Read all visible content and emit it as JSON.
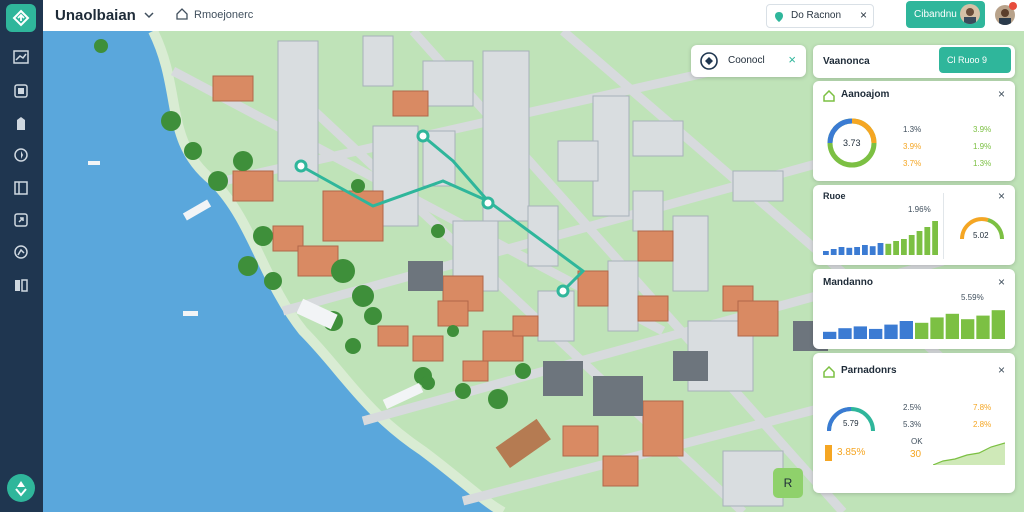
{
  "app": {
    "title": "Unaolbaian",
    "document_title": "Rmoejonerc",
    "search_chip": "Do Racnon",
    "user_button": "Cibandnu"
  },
  "sidebar": {
    "icons": [
      "layers-icon",
      "grid-icon",
      "building-icon",
      "compass-icon",
      "book-icon",
      "share-icon",
      "analytics-icon",
      "stack-icon"
    ],
    "fab_icon": "recycle-icon"
  },
  "map": {
    "popup_label": "Coonocl",
    "map_button_label": "R"
  },
  "panel": {
    "header": {
      "title": "Vaanonca",
      "action_label": "Cl Ruoo 9"
    },
    "card1": {
      "title": "Aanoajom",
      "donut_value": "3.73",
      "stats": [
        {
          "left": "1.3%",
          "right": "3.9%"
        },
        {
          "left": "3.9%",
          "right": "1.9%"
        },
        {
          "left": "3.7%",
          "right": "1.3%"
        }
      ]
    },
    "card2": {
      "title": "Ruoe",
      "right_small": "1.96%",
      "gauge_value": "5.02",
      "bars": [
        0.1,
        0.15,
        0.2,
        0.18,
        0.2,
        0.25,
        0.22,
        0.3,
        0.28,
        0.35,
        0.4,
        0.5,
        0.6,
        0.7,
        0.85
      ]
    },
    "card3": {
      "title": "Mandanno",
      "right_small": "5.59%",
      "bars": [
        0.2,
        0.3,
        0.35,
        0.28,
        0.4,
        0.5,
        0.45,
        0.6,
        0.7,
        0.55,
        0.65,
        0.8
      ]
    },
    "card4": {
      "title": "Parnadonrs",
      "arc_value": "5.79",
      "stats": [
        {
          "left": "2.5%",
          "right": "7.8%"
        },
        {
          "left": "5.3%",
          "right": "2.8%"
        }
      ],
      "bottom_value": "3.85%",
      "bottom_small": "OK",
      "bottom_mid": "30"
    }
  },
  "colors": {
    "accent": "#2fb69b",
    "water": "#5aa7dc",
    "sidebar": "#1f3650",
    "green_bar": "#7cc043",
    "blue_bar": "#3b7bd3"
  }
}
